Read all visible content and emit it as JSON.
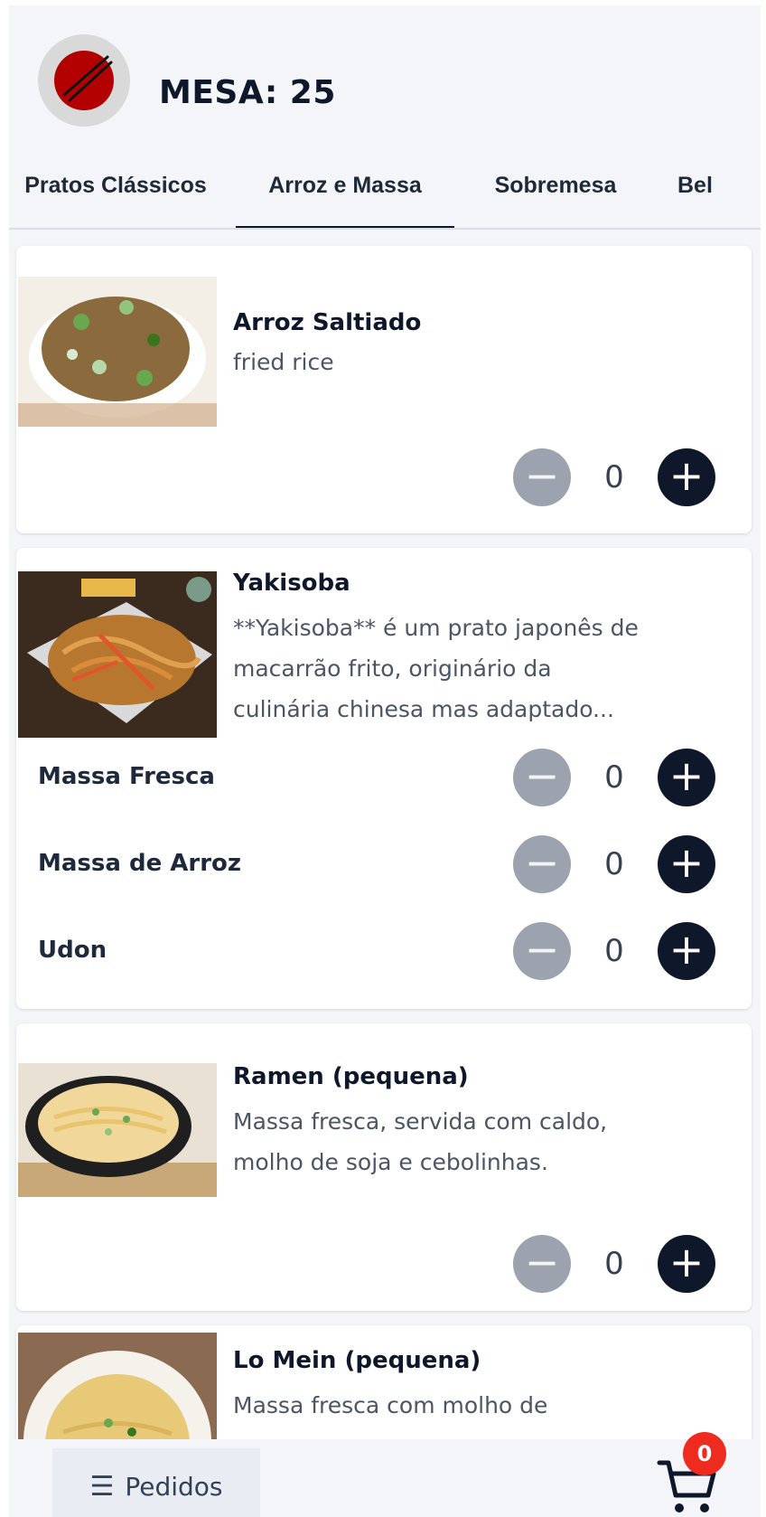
{
  "header": {
    "title": "MESA: 25",
    "logo_icon": "chopsticks-bowl-icon",
    "logo_colors": {
      "bowl": "#b30000",
      "ring": "#d9d9d9"
    }
  },
  "tabs": [
    {
      "label": "Pratos Clássicos",
      "active": false
    },
    {
      "label": "Arroz e Massa",
      "active": true
    },
    {
      "label": "Sobremesa",
      "active": false
    },
    {
      "label": "Bel",
      "active": false
    }
  ],
  "items": [
    {
      "name": "Arroz Saltiado",
      "description": "fried rice",
      "image": "fried-rice-photo",
      "quantity": "0"
    },
    {
      "name": "Yakisoba",
      "description": "**Yakisoba** é um prato japonês de macarrão frito, originário da culinária chinesa mas adaptado...",
      "image": "yakisoba-photo",
      "variants": [
        {
          "label": "Massa Fresca",
          "quantity": "0"
        },
        {
          "label": "Massa de Arroz",
          "quantity": "0"
        },
        {
          "label": "Udon",
          "quantity": "0"
        }
      ]
    },
    {
      "name": "Ramen (pequena)",
      "description": "Massa fresca, servida com caldo, molho de soja e cebolinhas.",
      "image": "ramen-photo",
      "quantity": "0"
    },
    {
      "name": "Lo Mein (pequena)",
      "description": "Massa fresca com molho de",
      "image": "lo-mein-photo"
    }
  ],
  "bottom_bar": {
    "orders_label": "Pedidos",
    "orders_icon": "list-icon",
    "cart_icon": "cart-icon",
    "cart_count": "0"
  },
  "colors": {
    "primary": "#0f172a",
    "minus_button": "#9ca3af",
    "badge": "#ef2b20",
    "background": "#f3f5f9"
  }
}
